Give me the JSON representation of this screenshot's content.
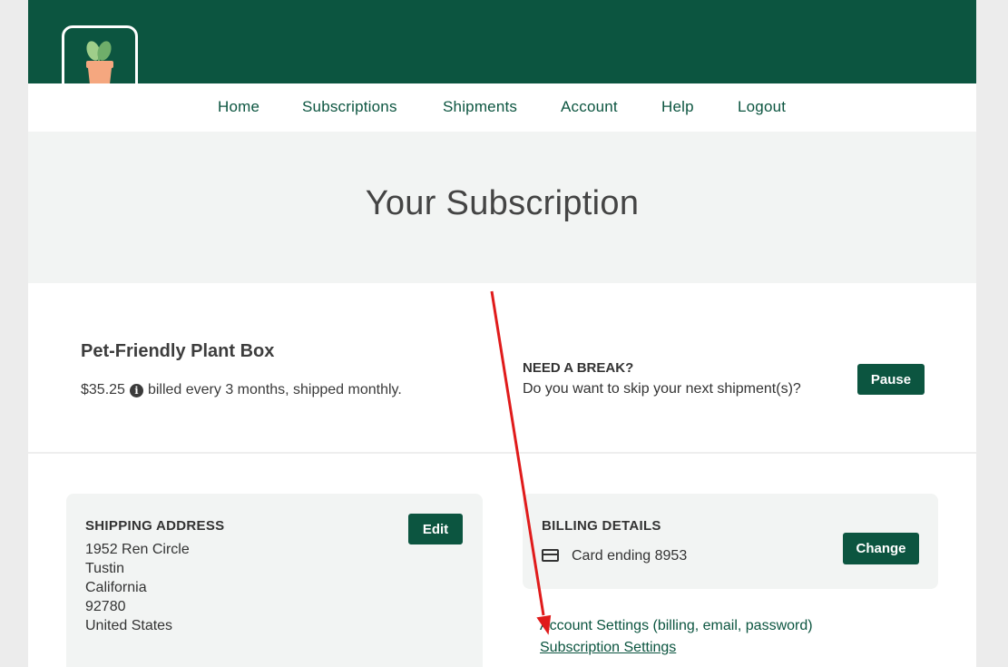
{
  "nav": {
    "items": [
      "Home",
      "Subscriptions",
      "Shipments",
      "Account",
      "Help",
      "Logout"
    ]
  },
  "logo": {
    "icon": "plant-pot-logo",
    "leaf_color": "#9fce8a",
    "pot_color": "#f5a77f"
  },
  "hero": {
    "title": "Your Subscription"
  },
  "plan": {
    "name": "Pet-Friendly Plant Box",
    "price": "$35.25",
    "billing": "billed every 3 months, shipped monthly."
  },
  "pause": {
    "heading": "NEED A BREAK?",
    "question": "Do you want to skip your next shipment(s)?",
    "button": "Pause"
  },
  "shipping": {
    "heading": "SHIPPING ADDRESS",
    "button": "Edit",
    "lines": [
      "1952 Ren Circle",
      "Tustin",
      "California",
      "92780",
      "United States"
    ]
  },
  "billing": {
    "heading": "BILLING DETAILS",
    "card_text": "Card ending 8953",
    "button": "Change"
  },
  "links": {
    "account_settings": "Account Settings (billing, email, password)",
    "subscription_settings": "Subscription Settings"
  },
  "colors": {
    "brand": "#0c5540",
    "annotation_arrow": "#e01b1b"
  }
}
